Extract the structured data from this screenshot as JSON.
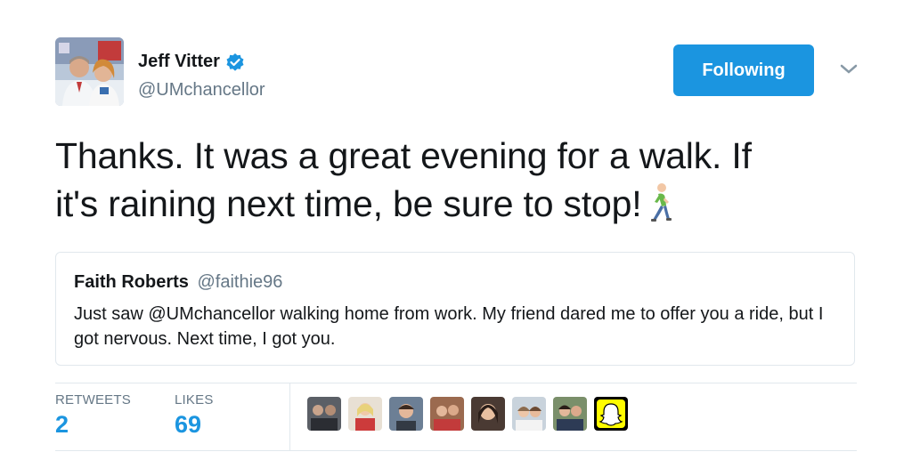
{
  "tweet": {
    "author_name": "Jeff Vitter",
    "author_handle": "@UMchancellor",
    "follow_button_label": "Following",
    "text_line1": "Thanks.  It was a great evening for a walk.  If",
    "text_line2": "it's raining next time, be sure to stop!"
  },
  "quoted_tweet": {
    "author_name": "Faith Roberts",
    "author_handle": "@faithie96",
    "text": "Just saw @UMchancellor walking home from work. My friend dared me to offer you a ride, but I got nervous. Next time, I got you."
  },
  "stats": {
    "retweets_label": "RETWEETS",
    "retweets_count": "2",
    "likes_label": "LIKES",
    "likes_count": "69"
  },
  "colors": {
    "accent": "#1b95e0",
    "text": "#14171a",
    "secondary_text": "#657786",
    "border": "#e1e8ed"
  },
  "icons": {
    "verified": "verified-badge-icon",
    "chevron": "chevron-down-icon",
    "walker_emoji": "person-walking-icon"
  }
}
